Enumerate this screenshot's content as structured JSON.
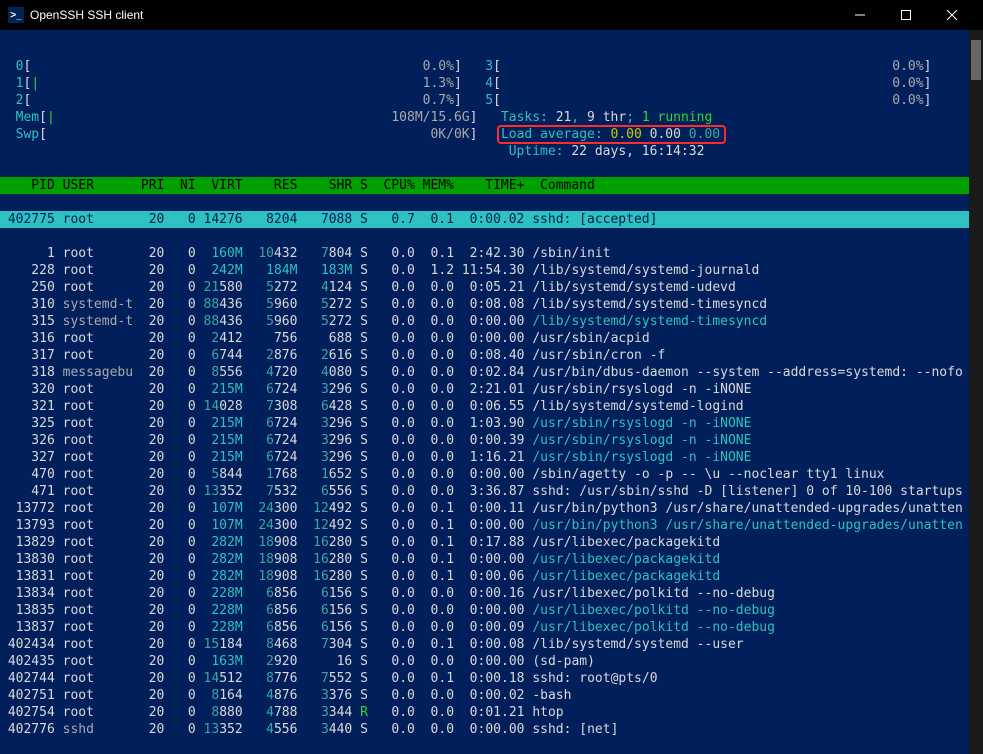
{
  "window": {
    "title": "OpenSSH SSH client"
  },
  "meters": {
    "cpus_left": [
      {
        "id": "0",
        "bar": "",
        "pct": "0.0%"
      },
      {
        "id": "1",
        "bar": "|",
        "pct": "1.3%"
      },
      {
        "id": "2",
        "bar": "",
        "pct": "0.7%"
      }
    ],
    "mem": {
      "label": "Mem",
      "bar": "|",
      "val": "108M/15.6G"
    },
    "swp": {
      "label": "Swp",
      "bar": "",
      "val": "0K/0K"
    },
    "cpus_right": [
      {
        "id": "3",
        "bar": "",
        "pct": "0.0%"
      },
      {
        "id": "4",
        "bar": "",
        "pct": "0.0%"
      },
      {
        "id": "5",
        "bar": "",
        "pct": "0.0%"
      }
    ],
    "tasks": {
      "label": "Tasks:",
      "total": "21",
      "sep": ",",
      "thr": "9 thr",
      "sep2": ";",
      "running": "1 running"
    },
    "load": {
      "label": "Load average:",
      "v1": "0.00",
      "v2": "0.00",
      "v3": "0.00"
    },
    "uptime": {
      "label": "Uptime:",
      "val": "22 days, 16:14:32"
    }
  },
  "header": [
    "PID",
    "USER",
    "PRI",
    "NI",
    "VIRT",
    "RES",
    "SHR",
    "S",
    "CPU%",
    "MEM%",
    "TIME+",
    "Command"
  ],
  "rows": [
    {
      "pid": "402775",
      "user": "root",
      "u": "wh",
      "pri": "20",
      "ni": "0",
      "virt": "14276",
      "res": "8204",
      "shr": "7088",
      "s": "S",
      "sc": "wh",
      "cpu": "0.7",
      "mem": "0.1",
      "time": "0:00.02",
      "cmd": "sshd: [accepted]",
      "cc": "wh",
      "sel": true
    },
    {
      "pid": "1",
      "user": "root",
      "u": "wh",
      "pri": "20",
      "ni": "0",
      "virt": "160M",
      "res": "10432",
      "shr": "7804",
      "s": "S",
      "sc": "wh",
      "cpu": "0.0",
      "mem": "0.1",
      "time": "2:42.30",
      "cmd": "/sbin/init",
      "cc": "wh"
    },
    {
      "pid": "228",
      "user": "root",
      "u": "wh",
      "pri": "20",
      "ni": "0",
      "virt": "242M",
      "res": "184M",
      "shr": "183M",
      "s": "S",
      "sc": "wh",
      "cpu": "0.0",
      "mem": "1.2",
      "time": "11:54.30",
      "cmd": "/lib/systemd/systemd-journald",
      "cc": "wh"
    },
    {
      "pid": "250",
      "user": "root",
      "u": "wh",
      "pri": "20",
      "ni": "0",
      "virt": "21580",
      "res": "5272",
      "shr": "4124",
      "s": "S",
      "sc": "wh",
      "cpu": "0.0",
      "mem": "0.0",
      "time": "0:05.21",
      "cmd": "/lib/systemd/systemd-udevd",
      "cc": "wh"
    },
    {
      "pid": "310",
      "user": "systemd-t",
      "u": "gr",
      "pri": "20",
      "ni": "0",
      "virt": "88436",
      "res": "5960",
      "shr": "5272",
      "s": "S",
      "sc": "wh",
      "cpu": "0.0",
      "mem": "0.0",
      "time": "0:08.08",
      "cmd": "/lib/systemd/systemd-timesyncd",
      "cc": "wh"
    },
    {
      "pid": "315",
      "user": "systemd-t",
      "u": "gr",
      "pri": "20",
      "ni": "0",
      "virt": "88436",
      "res": "5960",
      "shr": "5272",
      "s": "S",
      "sc": "wh",
      "cpu": "0.0",
      "mem": "0.0",
      "time": "0:00.00",
      "cmd": "/lib/systemd/systemd-timesyncd",
      "cc": "cy"
    },
    {
      "pid": "316",
      "user": "root",
      "u": "wh",
      "pri": "20",
      "ni": "0",
      "virt": "2412",
      "res": "756",
      "shr": "688",
      "s": "S",
      "sc": "wh",
      "cpu": "0.0",
      "mem": "0.0",
      "time": "0:00.00",
      "cmd": "/usr/sbin/acpid",
      "cc": "wh"
    },
    {
      "pid": "317",
      "user": "root",
      "u": "wh",
      "pri": "20",
      "ni": "0",
      "virt": "6744",
      "res": "2876",
      "shr": "2616",
      "s": "S",
      "sc": "wh",
      "cpu": "0.0",
      "mem": "0.0",
      "time": "0:08.40",
      "cmd": "/usr/sbin/cron -f",
      "cc": "wh"
    },
    {
      "pid": "318",
      "user": "messagebu",
      "u": "gr",
      "pri": "20",
      "ni": "0",
      "virt": "8556",
      "res": "4720",
      "shr": "4080",
      "s": "S",
      "sc": "wh",
      "cpu": "0.0",
      "mem": "0.0",
      "time": "0:02.84",
      "cmd": "/usr/bin/dbus-daemon --system --address=systemd: --nofo",
      "cc": "wh"
    },
    {
      "pid": "320",
      "user": "root",
      "u": "wh",
      "pri": "20",
      "ni": "0",
      "virt": "215M",
      "res": "6724",
      "shr": "3296",
      "s": "S",
      "sc": "wh",
      "cpu": "0.0",
      "mem": "0.0",
      "time": "2:21.01",
      "cmd": "/usr/sbin/rsyslogd -n -iNONE",
      "cc": "wh"
    },
    {
      "pid": "321",
      "user": "root",
      "u": "wh",
      "pri": "20",
      "ni": "0",
      "virt": "14028",
      "res": "7308",
      "shr": "6428",
      "s": "S",
      "sc": "wh",
      "cpu": "0.0",
      "mem": "0.0",
      "time": "0:06.55",
      "cmd": "/lib/systemd/systemd-logind",
      "cc": "wh"
    },
    {
      "pid": "325",
      "user": "root",
      "u": "wh",
      "pri": "20",
      "ni": "0",
      "virt": "215M",
      "res": "6724",
      "shr": "3296",
      "s": "S",
      "sc": "wh",
      "cpu": "0.0",
      "mem": "0.0",
      "time": "1:03.90",
      "cmd": "/usr/sbin/rsyslogd -n -iNONE",
      "cc": "cy"
    },
    {
      "pid": "326",
      "user": "root",
      "u": "wh",
      "pri": "20",
      "ni": "0",
      "virt": "215M",
      "res": "6724",
      "shr": "3296",
      "s": "S",
      "sc": "wh",
      "cpu": "0.0",
      "mem": "0.0",
      "time": "0:00.39",
      "cmd": "/usr/sbin/rsyslogd -n -iNONE",
      "cc": "cy"
    },
    {
      "pid": "327",
      "user": "root",
      "u": "wh",
      "pri": "20",
      "ni": "0",
      "virt": "215M",
      "res": "6724",
      "shr": "3296",
      "s": "S",
      "sc": "wh",
      "cpu": "0.0",
      "mem": "0.0",
      "time": "1:16.21",
      "cmd": "/usr/sbin/rsyslogd -n -iNONE",
      "cc": "cy"
    },
    {
      "pid": "470",
      "user": "root",
      "u": "wh",
      "pri": "20",
      "ni": "0",
      "virt": "5844",
      "res": "1768",
      "shr": "1652",
      "s": "S",
      "sc": "wh",
      "cpu": "0.0",
      "mem": "0.0",
      "time": "0:00.00",
      "cmd": "/sbin/agetty -o -p -- \\u --noclear tty1 linux",
      "cc": "wh"
    },
    {
      "pid": "471",
      "user": "root",
      "u": "wh",
      "pri": "20",
      "ni": "0",
      "virt": "13352",
      "res": "7532",
      "shr": "6556",
      "s": "S",
      "sc": "wh",
      "cpu": "0.0",
      "mem": "0.0",
      "time": "3:36.87",
      "cmd": "sshd: /usr/sbin/sshd -D [listener] 0 of 10-100 startups",
      "cc": "wh"
    },
    {
      "pid": "13772",
      "user": "root",
      "u": "wh",
      "pri": "20",
      "ni": "0",
      "virt": "107M",
      "res": "24300",
      "shr": "12492",
      "s": "S",
      "sc": "wh",
      "cpu": "0.0",
      "mem": "0.1",
      "time": "0:00.11",
      "cmd": "/usr/bin/python3 /usr/share/unattended-upgrades/unatten",
      "cc": "wh"
    },
    {
      "pid": "13793",
      "user": "root",
      "u": "wh",
      "pri": "20",
      "ni": "0",
      "virt": "107M",
      "res": "24300",
      "shr": "12492",
      "s": "S",
      "sc": "wh",
      "cpu": "0.0",
      "mem": "0.1",
      "time": "0:00.00",
      "cmd": "/usr/bin/python3 /usr/share/unattended-upgrades/unatten",
      "cc": "cy"
    },
    {
      "pid": "13829",
      "user": "root",
      "u": "wh",
      "pri": "20",
      "ni": "0",
      "virt": "282M",
      "res": "18908",
      "shr": "16280",
      "s": "S",
      "sc": "wh",
      "cpu": "0.0",
      "mem": "0.1",
      "time": "0:17.88",
      "cmd": "/usr/libexec/packagekitd",
      "cc": "wh"
    },
    {
      "pid": "13830",
      "user": "root",
      "u": "wh",
      "pri": "20",
      "ni": "0",
      "virt": "282M",
      "res": "18908",
      "shr": "16280",
      "s": "S",
      "sc": "wh",
      "cpu": "0.0",
      "mem": "0.1",
      "time": "0:00.00",
      "cmd": "/usr/libexec/packagekitd",
      "cc": "cy"
    },
    {
      "pid": "13831",
      "user": "root",
      "u": "wh",
      "pri": "20",
      "ni": "0",
      "virt": "282M",
      "res": "18908",
      "shr": "16280",
      "s": "S",
      "sc": "wh",
      "cpu": "0.0",
      "mem": "0.1",
      "time": "0:00.06",
      "cmd": "/usr/libexec/packagekitd",
      "cc": "cy"
    },
    {
      "pid": "13834",
      "user": "root",
      "u": "wh",
      "pri": "20",
      "ni": "0",
      "virt": "228M",
      "res": "6856",
      "shr": "6156",
      "s": "S",
      "sc": "wh",
      "cpu": "0.0",
      "mem": "0.0",
      "time": "0:00.16",
      "cmd": "/usr/libexec/polkitd --no-debug",
      "cc": "wh"
    },
    {
      "pid": "13835",
      "user": "root",
      "u": "wh",
      "pri": "20",
      "ni": "0",
      "virt": "228M",
      "res": "6856",
      "shr": "6156",
      "s": "S",
      "sc": "wh",
      "cpu": "0.0",
      "mem": "0.0",
      "time": "0:00.00",
      "cmd": "/usr/libexec/polkitd --no-debug",
      "cc": "cy"
    },
    {
      "pid": "13837",
      "user": "root",
      "u": "wh",
      "pri": "20",
      "ni": "0",
      "virt": "228M",
      "res": "6856",
      "shr": "6156",
      "s": "S",
      "sc": "wh",
      "cpu": "0.0",
      "mem": "0.0",
      "time": "0:00.09",
      "cmd": "/usr/libexec/polkitd --no-debug",
      "cc": "cy"
    },
    {
      "pid": "402434",
      "user": "root",
      "u": "wh",
      "pri": "20",
      "ni": "0",
      "virt": "15184",
      "res": "8468",
      "shr": "7304",
      "s": "S",
      "sc": "wh",
      "cpu": "0.0",
      "mem": "0.1",
      "time": "0:00.08",
      "cmd": "/lib/systemd/systemd --user",
      "cc": "wh"
    },
    {
      "pid": "402435",
      "user": "root",
      "u": "wh",
      "pri": "20",
      "ni": "0",
      "virt": "163M",
      "res": "2920",
      "shr": "16",
      "s": "S",
      "sc": "wh",
      "cpu": "0.0",
      "mem": "0.0",
      "time": "0:00.00",
      "cmd": "(sd-pam)",
      "cc": "wh"
    },
    {
      "pid": "402744",
      "user": "root",
      "u": "wh",
      "pri": "20",
      "ni": "0",
      "virt": "14512",
      "res": "8776",
      "shr": "7552",
      "s": "S",
      "sc": "wh",
      "cpu": "0.0",
      "mem": "0.1",
      "time": "0:00.18",
      "cmd": "sshd: root@pts/0",
      "cc": "wh"
    },
    {
      "pid": "402751",
      "user": "root",
      "u": "wh",
      "pri": "20",
      "ni": "0",
      "virt": "8164",
      "res": "4876",
      "shr": "3376",
      "s": "S",
      "sc": "wh",
      "cpu": "0.0",
      "mem": "0.0",
      "time": "0:00.02",
      "cmd": "-bash",
      "cc": "wh"
    },
    {
      "pid": "402754",
      "user": "root",
      "u": "wh",
      "pri": "20",
      "ni": "0",
      "virt": "8880",
      "res": "4788",
      "shr": "3344",
      "s": "R",
      "sc": "bg",
      "cpu": "0.0",
      "mem": "0.0",
      "time": "0:01.21",
      "cmd": "htop",
      "cc": "wh"
    },
    {
      "pid": "402776",
      "user": "sshd",
      "u": "gr",
      "pri": "20",
      "ni": "0",
      "virt": "13352",
      "res": "4556",
      "shr": "3440",
      "s": "S",
      "sc": "wh",
      "cpu": "0.0",
      "mem": "0.0",
      "time": "0:00.00",
      "cmd": "sshd: [net]",
      "cc": "wh"
    }
  ]
}
